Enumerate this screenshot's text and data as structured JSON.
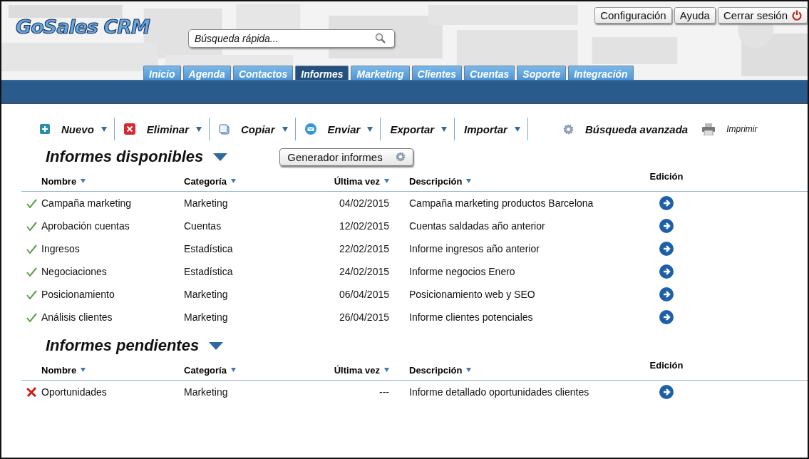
{
  "header": {
    "logo": "GoSales CRM",
    "search": {
      "placeholder": "Búsqueda rápida..."
    },
    "top_links": [
      {
        "label": "Configuración",
        "kind": "plain"
      },
      {
        "label": "Ayuda",
        "kind": "plain"
      },
      {
        "label": "Cerrar sesión",
        "kind": "logout"
      }
    ],
    "tabs": [
      {
        "label": "Inicio",
        "selected": false
      },
      {
        "label": "Agenda",
        "selected": false
      },
      {
        "label": "Contactos",
        "selected": false
      },
      {
        "label": "Informes",
        "selected": true
      },
      {
        "label": "Marketing",
        "selected": false
      },
      {
        "label": "Clientes",
        "selected": false
      },
      {
        "label": "Cuentas",
        "selected": false
      },
      {
        "label": "Soporte",
        "selected": false
      },
      {
        "label": "Integración",
        "selected": false
      }
    ]
  },
  "toolbar": [
    {
      "label": "Nuevo",
      "kind": "new",
      "dropdown": true
    },
    {
      "label": "Eliminar",
      "kind": "delete",
      "dropdown": true
    },
    {
      "label": "Copiar",
      "kind": "copy",
      "dropdown": true
    },
    {
      "label": "Enviar",
      "kind": "send",
      "dropdown": true
    },
    {
      "label": "Exportar",
      "kind": "plain",
      "dropdown": true
    },
    {
      "label": "Importar",
      "kind": "plain",
      "dropdown": true
    },
    {
      "label": "Búsqueda avanzada",
      "kind": "gear",
      "dropdown": false
    },
    {
      "label": "Imprimir",
      "kind": "print",
      "dropdown": false
    }
  ],
  "sections": [
    {
      "title": "Informes disponibles",
      "button": "Generador informes",
      "columns": [
        "Nombre",
        "Categoría",
        "Última vez",
        "Descripción",
        "Edición"
      ],
      "rows": [
        {
          "done": true,
          "cells": [
            "Campaña marketing",
            "Marketing",
            "04/02/2015",
            "Campaña marketing productos Barcelona"
          ]
        },
        {
          "done": true,
          "cells": [
            "Aprobación cuentas",
            "Cuentas",
            "12/02/2015",
            "Cuentas saldadas año anterior"
          ]
        },
        {
          "done": true,
          "cells": [
            "Ingresos",
            "Estadística",
            "22/02/2015",
            "Informe ingresos año anterior"
          ]
        },
        {
          "done": true,
          "cells": [
            "Negociaciones",
            "Estadística",
            "24/02/2015",
            "Informe negocios Enero"
          ]
        },
        {
          "done": true,
          "cells": [
            "Posicionamiento",
            "Marketing",
            "06/04/2015",
            "Posicionamiento web y SEO"
          ]
        },
        {
          "done": true,
          "cells": [
            "Análisis clientes",
            "Marketing",
            "26/04/2015",
            "Informe clientes potenciales"
          ]
        }
      ]
    },
    {
      "title": "Informes pendientes",
      "columns": [
        "Nombre",
        "Categoría",
        "Última vez",
        "Descripción",
        "Edición"
      ],
      "rows": [
        {
          "done": false,
          "cells": [
            "Oportunidades",
            "Marketing",
            "---",
            "Informe detallado oportunidades clientes"
          ]
        }
      ]
    }
  ]
}
